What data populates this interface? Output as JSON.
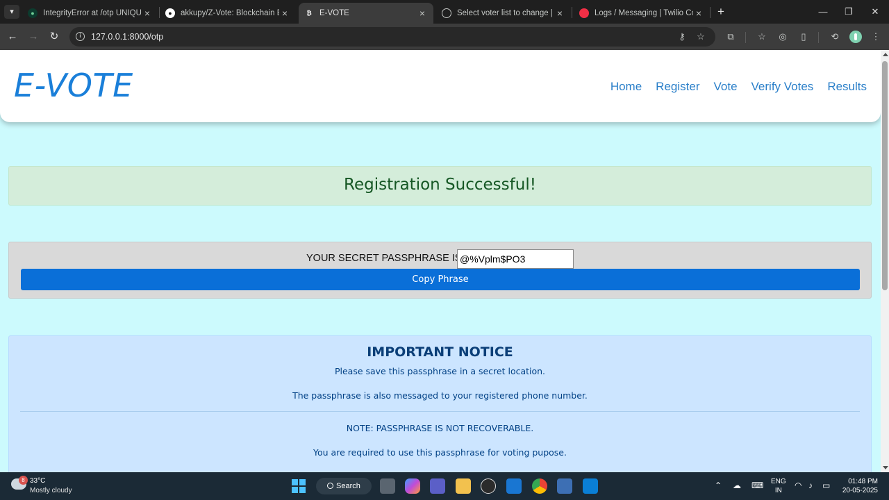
{
  "browser": {
    "tabs": [
      {
        "title": "IntegrityError at /otp UNIQUE c",
        "active": false
      },
      {
        "title": "akkupy/Z-Vote: Blockchain Bas",
        "active": false
      },
      {
        "title": "E-VOTE",
        "active": true
      },
      {
        "title": "Select voter list to change | Dja",
        "active": false
      },
      {
        "title": "Logs / Messaging | Twilio Cons",
        "active": false
      }
    ],
    "url": "127.0.0.1:8000/otp"
  },
  "site": {
    "logo": "E-VOTE",
    "nav": [
      "Home",
      "Register",
      "Vote",
      "Verify Votes",
      "Results"
    ]
  },
  "success": {
    "message": "Registration Successful!"
  },
  "passphrase": {
    "label": "YOUR SECRET PASSPHRASE IS :",
    "value": "@%Vplm$PO3",
    "copy_button": "Copy Phrase"
  },
  "notice": {
    "title": "IMPORTANT NOTICE",
    "line1": "Please save this passphrase in a secret location.",
    "line2": "The passphrase is also messaged to your registered phone number.",
    "line3": "NOTE: PASSPHRASE IS NOT RECOVERABLE.",
    "line4": "You are required to use this passphrase for voting pupose."
  },
  "taskbar": {
    "weather_badge": "8",
    "temperature": "33°C",
    "weather": "Mostly cloudy",
    "search": "Search",
    "lang_top": "ENG",
    "lang_bottom": "IN",
    "time": "01:48 PM",
    "date": "20-05-2025"
  },
  "colors": {
    "page_bg": "#ccfafd",
    "brand": "#1a7fd9",
    "success_bg": "#d4edda",
    "success_text": "#155724",
    "button": "#0a6fd8",
    "notice_bg": "#cce5ff"
  }
}
